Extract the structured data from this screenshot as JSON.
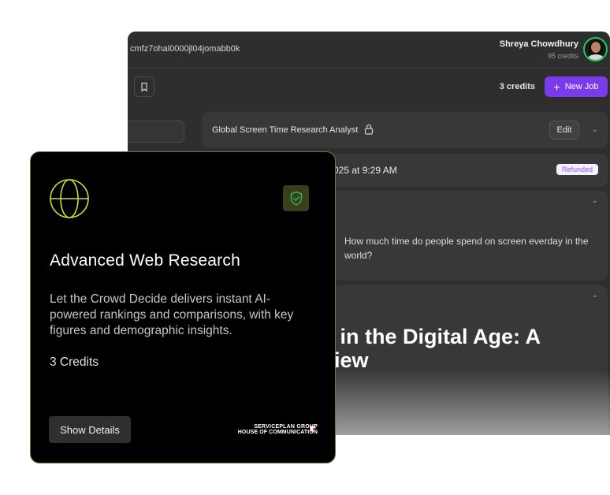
{
  "app": {
    "job_id": "cmfz7ohal0000jl04jomabb0k",
    "user": {
      "name": "Shreya Chowdhury",
      "credits": "95 credits"
    },
    "header": {
      "credits": "3 credits",
      "new_job_label": "New Job"
    },
    "job": {
      "title": "Global Screen Time Research Analyst",
      "edit_label": "Edit",
      "date_fragment": "025 at 9:29 AM",
      "status": "Refunded",
      "question": "How much time do people spend on screen everday in the world?",
      "headline_line1": "e in the Digital Age: A",
      "headline_line2": "view"
    }
  },
  "product_card": {
    "title": "Advanced Web Research",
    "description": "Let the Crowd Decide delivers instant AI-powered rankings and comparisons, with key figures and demographic insights.",
    "credits": "3 Credits",
    "details_label": "Show Details",
    "brand_line1": "SERVICEPLAN GROUP",
    "brand_line2": "HOUSE OF COMMUNICATION",
    "accent_color": "#c6e03a"
  }
}
